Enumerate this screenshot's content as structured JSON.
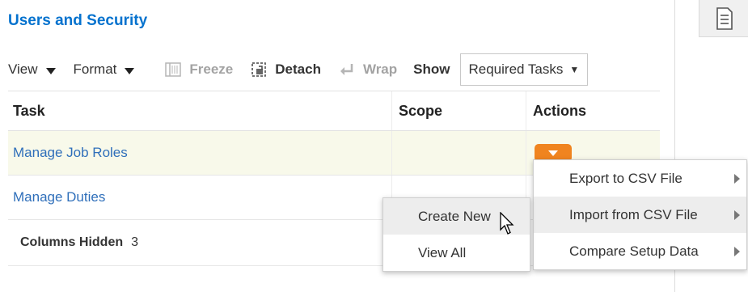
{
  "header": {
    "title": "Users and Security"
  },
  "toolbar": {
    "view_label": "View",
    "format_label": "Format",
    "freeze_label": "Freeze",
    "detach_label": "Detach",
    "wrap_label": "Wrap",
    "show_label": "Show",
    "show_select_value": "Required Tasks"
  },
  "table": {
    "columns": [
      "Task",
      "Scope",
      "Actions"
    ],
    "rows": [
      {
        "task": "Manage Job Roles",
        "scope": ""
      },
      {
        "task": "Manage Duties",
        "scope": ""
      }
    ],
    "footer": {
      "label": "Columns Hidden",
      "count": "3"
    }
  },
  "actions_menu": {
    "items": [
      {
        "label": "Export to CSV File",
        "has_submenu": true
      },
      {
        "label": "Import from CSV File",
        "has_submenu": true
      },
      {
        "label": "Compare Setup Data",
        "has_submenu": true
      }
    ]
  },
  "submenu": {
    "items": [
      {
        "label": "Create New"
      },
      {
        "label": "View All"
      }
    ]
  },
  "colors": {
    "title": "#0572ce",
    "link": "#2f6fba",
    "actions_button": "#f0841f",
    "selected_row": "#f8f9ea",
    "menu_hover": "#ededed"
  },
  "icons": {
    "freeze": "freeze-columns-icon",
    "detach": "detach-icon",
    "wrap": "wrap-icon",
    "side_panel": "document-list-icon"
  }
}
